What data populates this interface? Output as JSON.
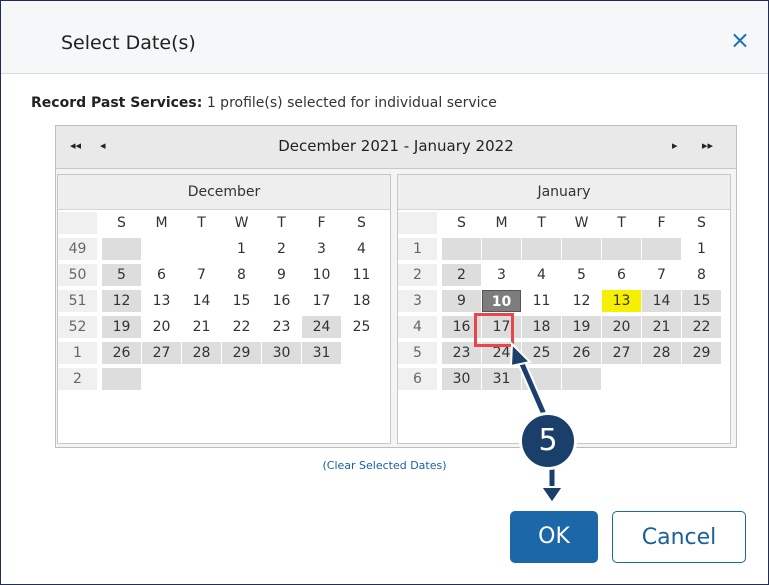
{
  "dialog": {
    "title": "Select Date(s)",
    "close_icon": "×"
  },
  "record": {
    "label": "Record Past Services",
    "colon": ":",
    "text": " 1 profile(s) selected for individual service"
  },
  "nav": {
    "first": "◂◂",
    "prev": "◂",
    "title": "December 2021 - January 2022",
    "next": "▸",
    "last": "▸▸"
  },
  "months": [
    {
      "name": "December",
      "dows": [
        "S",
        "M",
        "T",
        "W",
        "T",
        "F",
        "S"
      ],
      "weeks": [
        {
          "wk": "49",
          "days": [
            {
              "t": "",
              "c": "g"
            },
            {
              "t": "",
              "c": ""
            },
            {
              "t": "",
              "c": ""
            },
            {
              "t": "1",
              "c": ""
            },
            {
              "t": "2",
              "c": ""
            },
            {
              "t": "3",
              "c": ""
            },
            {
              "t": "4",
              "c": ""
            }
          ]
        },
        {
          "wk": "50",
          "days": [
            {
              "t": "5",
              "c": "g"
            },
            {
              "t": "6",
              "c": ""
            },
            {
              "t": "7",
              "c": ""
            },
            {
              "t": "8",
              "c": ""
            },
            {
              "t": "9",
              "c": ""
            },
            {
              "t": "10",
              "c": ""
            },
            {
              "t": "11",
              "c": ""
            }
          ]
        },
        {
          "wk": "51",
          "days": [
            {
              "t": "12",
              "c": "g"
            },
            {
              "t": "13",
              "c": ""
            },
            {
              "t": "14",
              "c": ""
            },
            {
              "t": "15",
              "c": ""
            },
            {
              "t": "16",
              "c": ""
            },
            {
              "t": "17",
              "c": ""
            },
            {
              "t": "18",
              "c": ""
            }
          ]
        },
        {
          "wk": "52",
          "days": [
            {
              "t": "19",
              "c": "g"
            },
            {
              "t": "20",
              "c": ""
            },
            {
              "t": "21",
              "c": ""
            },
            {
              "t": "22",
              "c": ""
            },
            {
              "t": "23",
              "c": ""
            },
            {
              "t": "24",
              "c": "g"
            },
            {
              "t": "25",
              "c": ""
            }
          ]
        },
        {
          "wk": "1",
          "days": [
            {
              "t": "26",
              "c": "g"
            },
            {
              "t": "27",
              "c": "g"
            },
            {
              "t": "28",
              "c": "g"
            },
            {
              "t": "29",
              "c": "g"
            },
            {
              "t": "30",
              "c": "g"
            },
            {
              "t": "31",
              "c": "g"
            },
            {
              "t": "",
              "c": ""
            }
          ]
        },
        {
          "wk": "2",
          "days": [
            {
              "t": "",
              "c": "g"
            },
            {
              "t": "",
              "c": ""
            },
            {
              "t": "",
              "c": ""
            },
            {
              "t": "",
              "c": ""
            },
            {
              "t": "",
              "c": ""
            },
            {
              "t": "",
              "c": ""
            },
            {
              "t": "",
              "c": ""
            }
          ]
        }
      ]
    },
    {
      "name": "January",
      "dows": [
        "S",
        "M",
        "T",
        "W",
        "T",
        "F",
        "S"
      ],
      "weeks": [
        {
          "wk": "1",
          "days": [
            {
              "t": "",
              "c": "g"
            },
            {
              "t": "",
              "c": "g"
            },
            {
              "t": "",
              "c": "g"
            },
            {
              "t": "",
              "c": "g"
            },
            {
              "t": "",
              "c": "g"
            },
            {
              "t": "",
              "c": "g"
            },
            {
              "t": "1",
              "c": ""
            }
          ]
        },
        {
          "wk": "2",
          "days": [
            {
              "t": "2",
              "c": "g"
            },
            {
              "t": "3",
              "c": ""
            },
            {
              "t": "4",
              "c": ""
            },
            {
              "t": "5",
              "c": ""
            },
            {
              "t": "6",
              "c": ""
            },
            {
              "t": "7",
              "c": ""
            },
            {
              "t": "8",
              "c": ""
            }
          ]
        },
        {
          "wk": "3",
          "days": [
            {
              "t": "9",
              "c": "g"
            },
            {
              "t": "10",
              "c": "sel"
            },
            {
              "t": "11",
              "c": ""
            },
            {
              "t": "12",
              "c": ""
            },
            {
              "t": "13",
              "c": "today"
            },
            {
              "t": "14",
              "c": "g"
            },
            {
              "t": "15",
              "c": "g"
            }
          ]
        },
        {
          "wk": "4",
          "days": [
            {
              "t": "16",
              "c": "g"
            },
            {
              "t": "17",
              "c": "g"
            },
            {
              "t": "18",
              "c": "g"
            },
            {
              "t": "19",
              "c": "g"
            },
            {
              "t": "20",
              "c": "g"
            },
            {
              "t": "21",
              "c": "g"
            },
            {
              "t": "22",
              "c": "g"
            }
          ]
        },
        {
          "wk": "5",
          "days": [
            {
              "t": "23",
              "c": "g"
            },
            {
              "t": "24",
              "c": "g"
            },
            {
              "t": "25",
              "c": "g"
            },
            {
              "t": "26",
              "c": "g"
            },
            {
              "t": "27",
              "c": "g"
            },
            {
              "t": "28",
              "c": "g"
            },
            {
              "t": "29",
              "c": "g"
            }
          ]
        },
        {
          "wk": "6",
          "days": [
            {
              "t": "30",
              "c": "g"
            },
            {
              "t": "31",
              "c": "g"
            },
            {
              "t": "",
              "c": "g"
            },
            {
              "t": "",
              "c": "g"
            },
            {
              "t": "",
              "c": ""
            },
            {
              "t": "",
              "c": ""
            },
            {
              "t": "",
              "c": ""
            }
          ]
        }
      ]
    }
  ],
  "clear_link": "(Clear Selected Dates)",
  "buttons": {
    "ok": "OK",
    "cancel": "Cancel"
  },
  "callout": {
    "step": "5"
  },
  "colors": {
    "accent": "#1b67a8",
    "highlight_box": "#e8464c",
    "today": "#f7ef00",
    "callout": "#1a3f6a"
  }
}
